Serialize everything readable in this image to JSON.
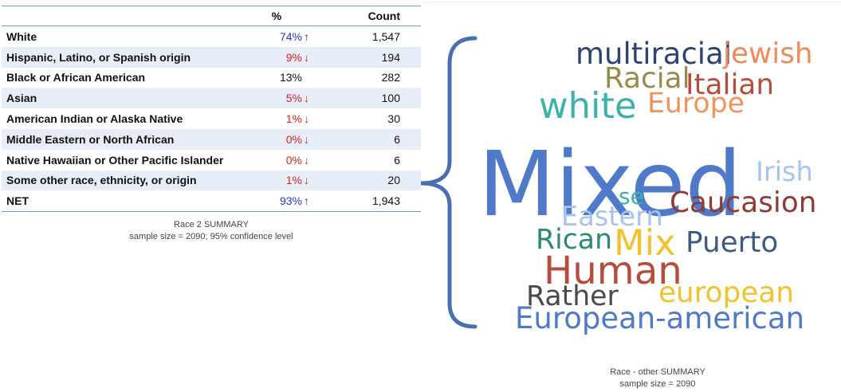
{
  "table": {
    "headers": {
      "category": "",
      "percent": "%",
      "count": "Count"
    },
    "rows": [
      {
        "category": "White",
        "percent": "74%",
        "count": "1,547",
        "trend": "up"
      },
      {
        "category": "Hispanic, Latino, or Spanish origin",
        "percent": "9%",
        "count": "194",
        "trend": "down"
      },
      {
        "category": "Black or African American",
        "percent": "13%",
        "count": "282",
        "trend": "none"
      },
      {
        "category": "Asian",
        "percent": "5%",
        "count": "100",
        "trend": "down"
      },
      {
        "category": "American Indian or Alaska Native",
        "percent": "1%",
        "count": "30",
        "trend": "down"
      },
      {
        "category": "Middle Eastern or North African",
        "percent": "0%",
        "count": "6",
        "trend": "down"
      },
      {
        "category": "Native Hawaiian or Other Pacific Islander",
        "percent": "0%",
        "count": "6",
        "trend": "down"
      },
      {
        "category": "Some other race, ethnicity, or origin",
        "percent": "1%",
        "count": "20",
        "trend": "down"
      },
      {
        "category": "NET",
        "percent": "93%",
        "count": "1,943",
        "trend": "up"
      }
    ],
    "caption_title": "Race 2 SUMMARY",
    "caption_detail": "sample size = 2090; 95% confidence level"
  },
  "colors": {
    "up": "#1f35d6",
    "down": "#e02020",
    "brace": "#4a6fb0",
    "header_rule": "#6f9bd3",
    "stripe": "#e7eef8"
  },
  "icons": {
    "up": "arrow-up-icon",
    "down": "arrow-down-icon"
  },
  "chart_data": {
    "type": "wordcloud",
    "words": [
      {
        "text": "Mixed",
        "weight": 100,
        "color": "#4f79c9"
      },
      {
        "text": "Human",
        "weight": 43,
        "color": "#b84c3c"
      },
      {
        "text": "white",
        "weight": 40,
        "color": "#3bb3a8"
      },
      {
        "text": "Mix",
        "weight": 40,
        "color": "#f2c12e"
      },
      {
        "text": "multiracial",
        "weight": 33,
        "color": "#2e4373"
      },
      {
        "text": "European-american",
        "weight": 33,
        "color": "#4f79c9"
      },
      {
        "text": "Caucasion",
        "weight": 32,
        "color": "#8f3a35"
      },
      {
        "text": "european",
        "weight": 32,
        "color": "#f2c12e"
      },
      {
        "text": "Italian",
        "weight": 32,
        "color": "#b84c3c"
      },
      {
        "text": "jewish",
        "weight": 32,
        "color": "#ef8a5b"
      },
      {
        "text": "Racial",
        "weight": 32,
        "color": "#9a8a4a"
      },
      {
        "text": "Puerto",
        "weight": 32,
        "color": "#3d5a80"
      },
      {
        "text": "Rican",
        "weight": 31,
        "color": "#2a8a77"
      },
      {
        "text": "Europe",
        "weight": 31,
        "color": "#f0945c"
      },
      {
        "text": "Rather",
        "weight": 31,
        "color": "#4a4a4a"
      },
      {
        "text": "Eastern",
        "weight": 30,
        "color": "#a6c4ef"
      },
      {
        "text": "Irish",
        "weight": 30,
        "color": "#a6c4ef"
      },
      {
        "text": "se",
        "weight": 25,
        "color": "#3bb3a8"
      }
    ],
    "caption_title": "Race - other SUMMARY",
    "caption_detail": "sample size = 2090"
  }
}
